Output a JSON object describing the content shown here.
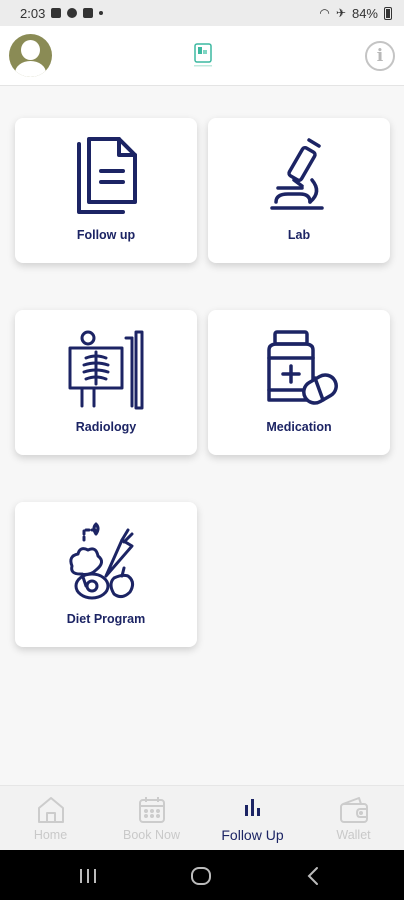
{
  "status_bar": {
    "time": "2:03",
    "battery": "84%"
  },
  "header": {
    "avatar": "user-avatar",
    "logo": "app-logo",
    "info": "i"
  },
  "cards": [
    {
      "label": "Follow up",
      "icon": "documents-icon"
    },
    {
      "label": "Lab",
      "icon": "microscope-icon"
    },
    {
      "label": "Radiology",
      "icon": "xray-icon"
    },
    {
      "label": "Medication",
      "icon": "medicine-bottle-icon"
    },
    {
      "label": "Diet Program",
      "icon": "vegetables-icon"
    }
  ],
  "bottom_nav": [
    {
      "label": "Home",
      "icon": "home-icon",
      "active": false
    },
    {
      "label": "Book Now",
      "icon": "calendar-icon",
      "active": false
    },
    {
      "label": "Follow Up",
      "icon": "bar-chart-icon",
      "active": true
    },
    {
      "label": "Wallet",
      "icon": "wallet-icon",
      "active": false
    }
  ],
  "colors": {
    "accent": "#1c2464",
    "avatar": "#8a8b55",
    "logo": "#3cb8a0",
    "inactive": "#c9c9c9"
  }
}
